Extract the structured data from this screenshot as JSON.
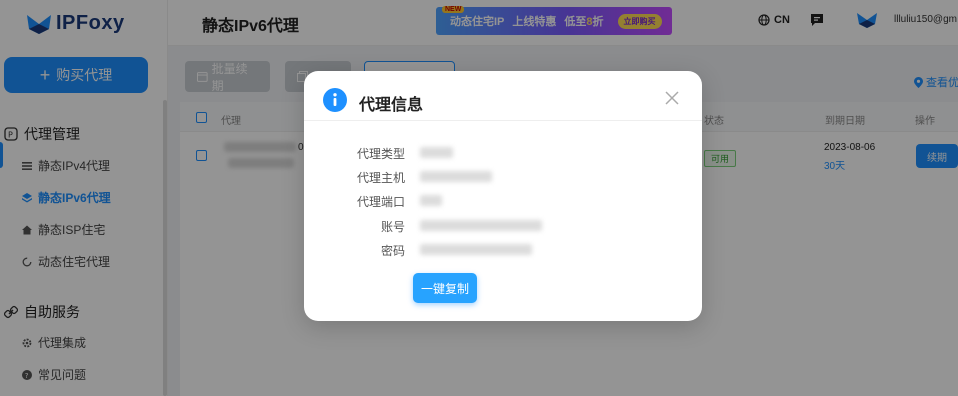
{
  "app": {
    "logo_text": "IPFoxy"
  },
  "sidebar": {
    "buy_label": "购买代理",
    "groups": [
      {
        "title": "代理管理",
        "items": [
          "静态IPv4代理",
          "静态IPv6代理",
          "静态ISP住宅",
          "动态住宅代理"
        ]
      },
      {
        "title": "自助服务",
        "items": [
          "代理集成",
          "常见问题"
        ]
      }
    ],
    "active_item": "静态IPv6代理"
  },
  "header": {
    "page_title": "静态IPv6代理",
    "banner": {
      "badge": "NEW",
      "text": "动态住宅IP",
      "promo": "上线特惠",
      "discount_prefix": "低至",
      "discount_value": "8",
      "discount_suffix": "折",
      "button": "立即购买"
    },
    "lang": "CN",
    "user_name": "llluliu150@gm"
  },
  "toolbar": {
    "renew_label": "批量续期",
    "view_link": "查看优"
  },
  "table": {
    "headers": {
      "proxy": "代理",
      "status": "状态",
      "expiry": "到期日期",
      "action": "操作"
    },
    "rows": [
      {
        "proxy_suffix": "0",
        "status": "可用",
        "expiry_date": "2023-08-06",
        "expiry_days": "30天",
        "action": "续期"
      }
    ]
  },
  "modal": {
    "title": "代理信息",
    "fields": [
      {
        "label": "代理类型"
      },
      {
        "label": "代理主机"
      },
      {
        "label": "代理端口"
      },
      {
        "label": "账号"
      },
      {
        "label": "密码"
      }
    ],
    "copy_button": "一键复制"
  },
  "colors": {
    "primary": "#1e90ff",
    "brand": "#1a3a7a",
    "success": "#2e9b2e"
  }
}
